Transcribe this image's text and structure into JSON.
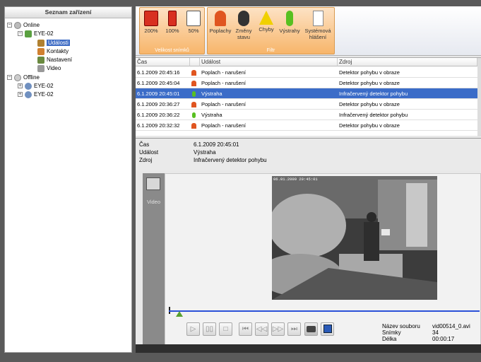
{
  "left_panel": {
    "title": "Seznam zařízení",
    "tree": {
      "online": "Online",
      "eye02": "EYE-02",
      "udalosti": "Události",
      "kontakty": "Kontakty",
      "nastaveni": "Nastavení",
      "video": "Video",
      "offline": "Offline",
      "offline_eye1": "EYE-02",
      "offline_eye2": "EYE-02"
    }
  },
  "ribbon": {
    "size_group": {
      "label": "Velikost snímků",
      "buttons": [
        "200%",
        "100%",
        "50%"
      ]
    },
    "filter_group": {
      "label": "Filtr",
      "buttons": [
        "Poplachy",
        "Změny stavu",
        "Chyby",
        "Výstrahy",
        "Systémová hlášení"
      ]
    }
  },
  "table": {
    "headers": [
      "Čas",
      "Událost",
      "Zdroj"
    ],
    "rows": [
      {
        "time": "6.1.2009 20:45:16",
        "type": "alarm",
        "event": "Poplach - narušení",
        "source": "Detektor pohybu v obraze"
      },
      {
        "time": "6.1.2009 20:45:04",
        "type": "alarm",
        "event": "Poplach - narušení",
        "source": "Detektor pohybu v obraze"
      },
      {
        "time": "6.1.2009 20:45:01",
        "type": "warn",
        "event": "Výstraha",
        "source": "Infračervený detektor pohybu"
      },
      {
        "time": "6.1.2009 20:36:27",
        "type": "alarm",
        "event": "Poplach - narušení",
        "source": "Detektor pohybu v obraze"
      },
      {
        "time": "6.1.2009 20:36:22",
        "type": "warn",
        "event": "Výstraha",
        "source": "Infračervený detektor pohybu"
      },
      {
        "time": "6.1.2009 20:32:32",
        "type": "alarm",
        "event": "Poplach - narušení",
        "source": "Detektor pohybu v obraze"
      }
    ],
    "selected_row": 2
  },
  "details": {
    "cas_label": "Čas",
    "cas_value": "6.1.2009 20:45:01",
    "udalost_label": "Událost",
    "udalost_value": "Výstraha",
    "zdroj_label": "Zdroj",
    "zdroj_value": "Infračervený detektor pohybu"
  },
  "side": {
    "video_label": "Video"
  },
  "video": {
    "timestamp": "06.01.2009 20:45:01"
  },
  "file_info": {
    "name_label": "Název souboru",
    "name_value": "vid00514_0.avi",
    "frames_label": "Snímky",
    "frames_value": "34",
    "length_label": "Délka",
    "length_value": "00:00:17"
  },
  "colors": {
    "selection": "#3b6cc8",
    "ribbon_group": "#f7b56a",
    "timeline": "#2a50d8"
  }
}
